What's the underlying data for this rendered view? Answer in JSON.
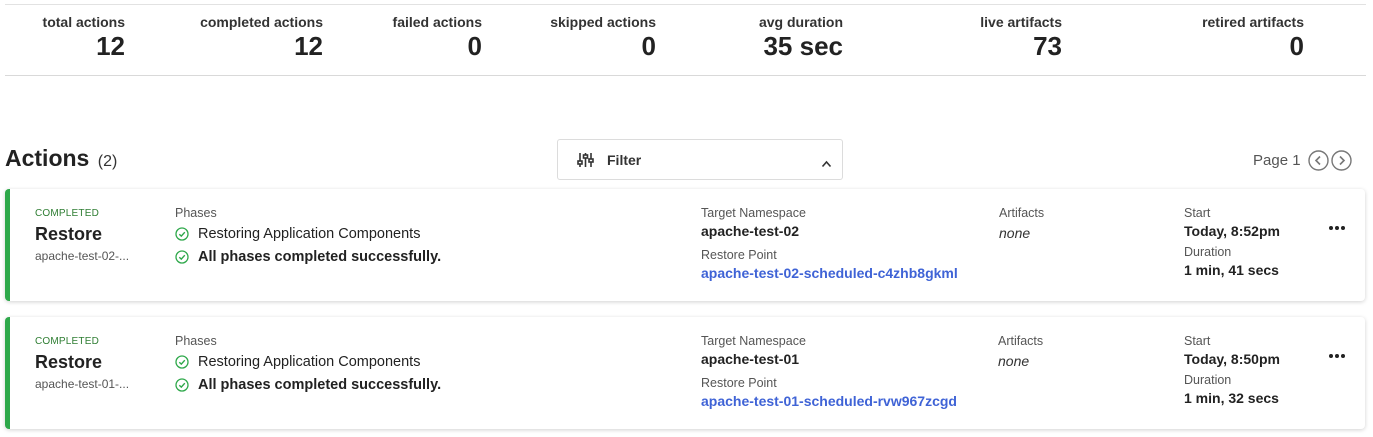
{
  "stats": [
    {
      "label": "total actions",
      "value": "12"
    },
    {
      "label": "completed actions",
      "value": "12"
    },
    {
      "label": "failed actions",
      "value": "0"
    },
    {
      "label": "skipped actions",
      "value": "0"
    },
    {
      "label": "avg duration",
      "value": "35 sec"
    },
    {
      "label": "live artifacts",
      "value": "73"
    },
    {
      "label": "retired artifacts",
      "value": "0"
    }
  ],
  "header": {
    "title": "Actions",
    "count": "(2)",
    "filter_label": "Filter",
    "page_label": "Page 1"
  },
  "labels": {
    "phases": "Phases",
    "target_namespace": "Target Namespace",
    "restore_point": "Restore Point",
    "artifacts": "Artifacts",
    "start": "Start",
    "duration": "Duration"
  },
  "cards": [
    {
      "status": "COMPLETED",
      "title": "Restore",
      "subtitle": "apache-test-02-...",
      "phases": [
        "Restoring Application Components",
        "All phases completed successfully."
      ],
      "target_namespace": "apache-test-02",
      "restore_point": "apache-test-02-scheduled-c4zhb8gkml",
      "artifacts": "none",
      "start": "Today, 8:52pm",
      "duration": "1 min, 41 secs"
    },
    {
      "status": "COMPLETED",
      "title": "Restore",
      "subtitle": "apache-test-01-...",
      "phases": [
        "Restoring Application Components",
        "All phases completed successfully."
      ],
      "target_namespace": "apache-test-01",
      "restore_point": "apache-test-01-scheduled-rvw967zcgd",
      "artifacts": "none",
      "start": "Today, 8:50pm",
      "duration": "1 min, 32 secs"
    }
  ],
  "colors": {
    "accent_green": "#2ea84a",
    "link_blue": "#3f63d6"
  },
  "icons": [
    "sliders-icon",
    "chevron-up-icon",
    "chevron-left-icon",
    "chevron-right-icon",
    "check-circle-icon",
    "more-horizontal-icon"
  ]
}
